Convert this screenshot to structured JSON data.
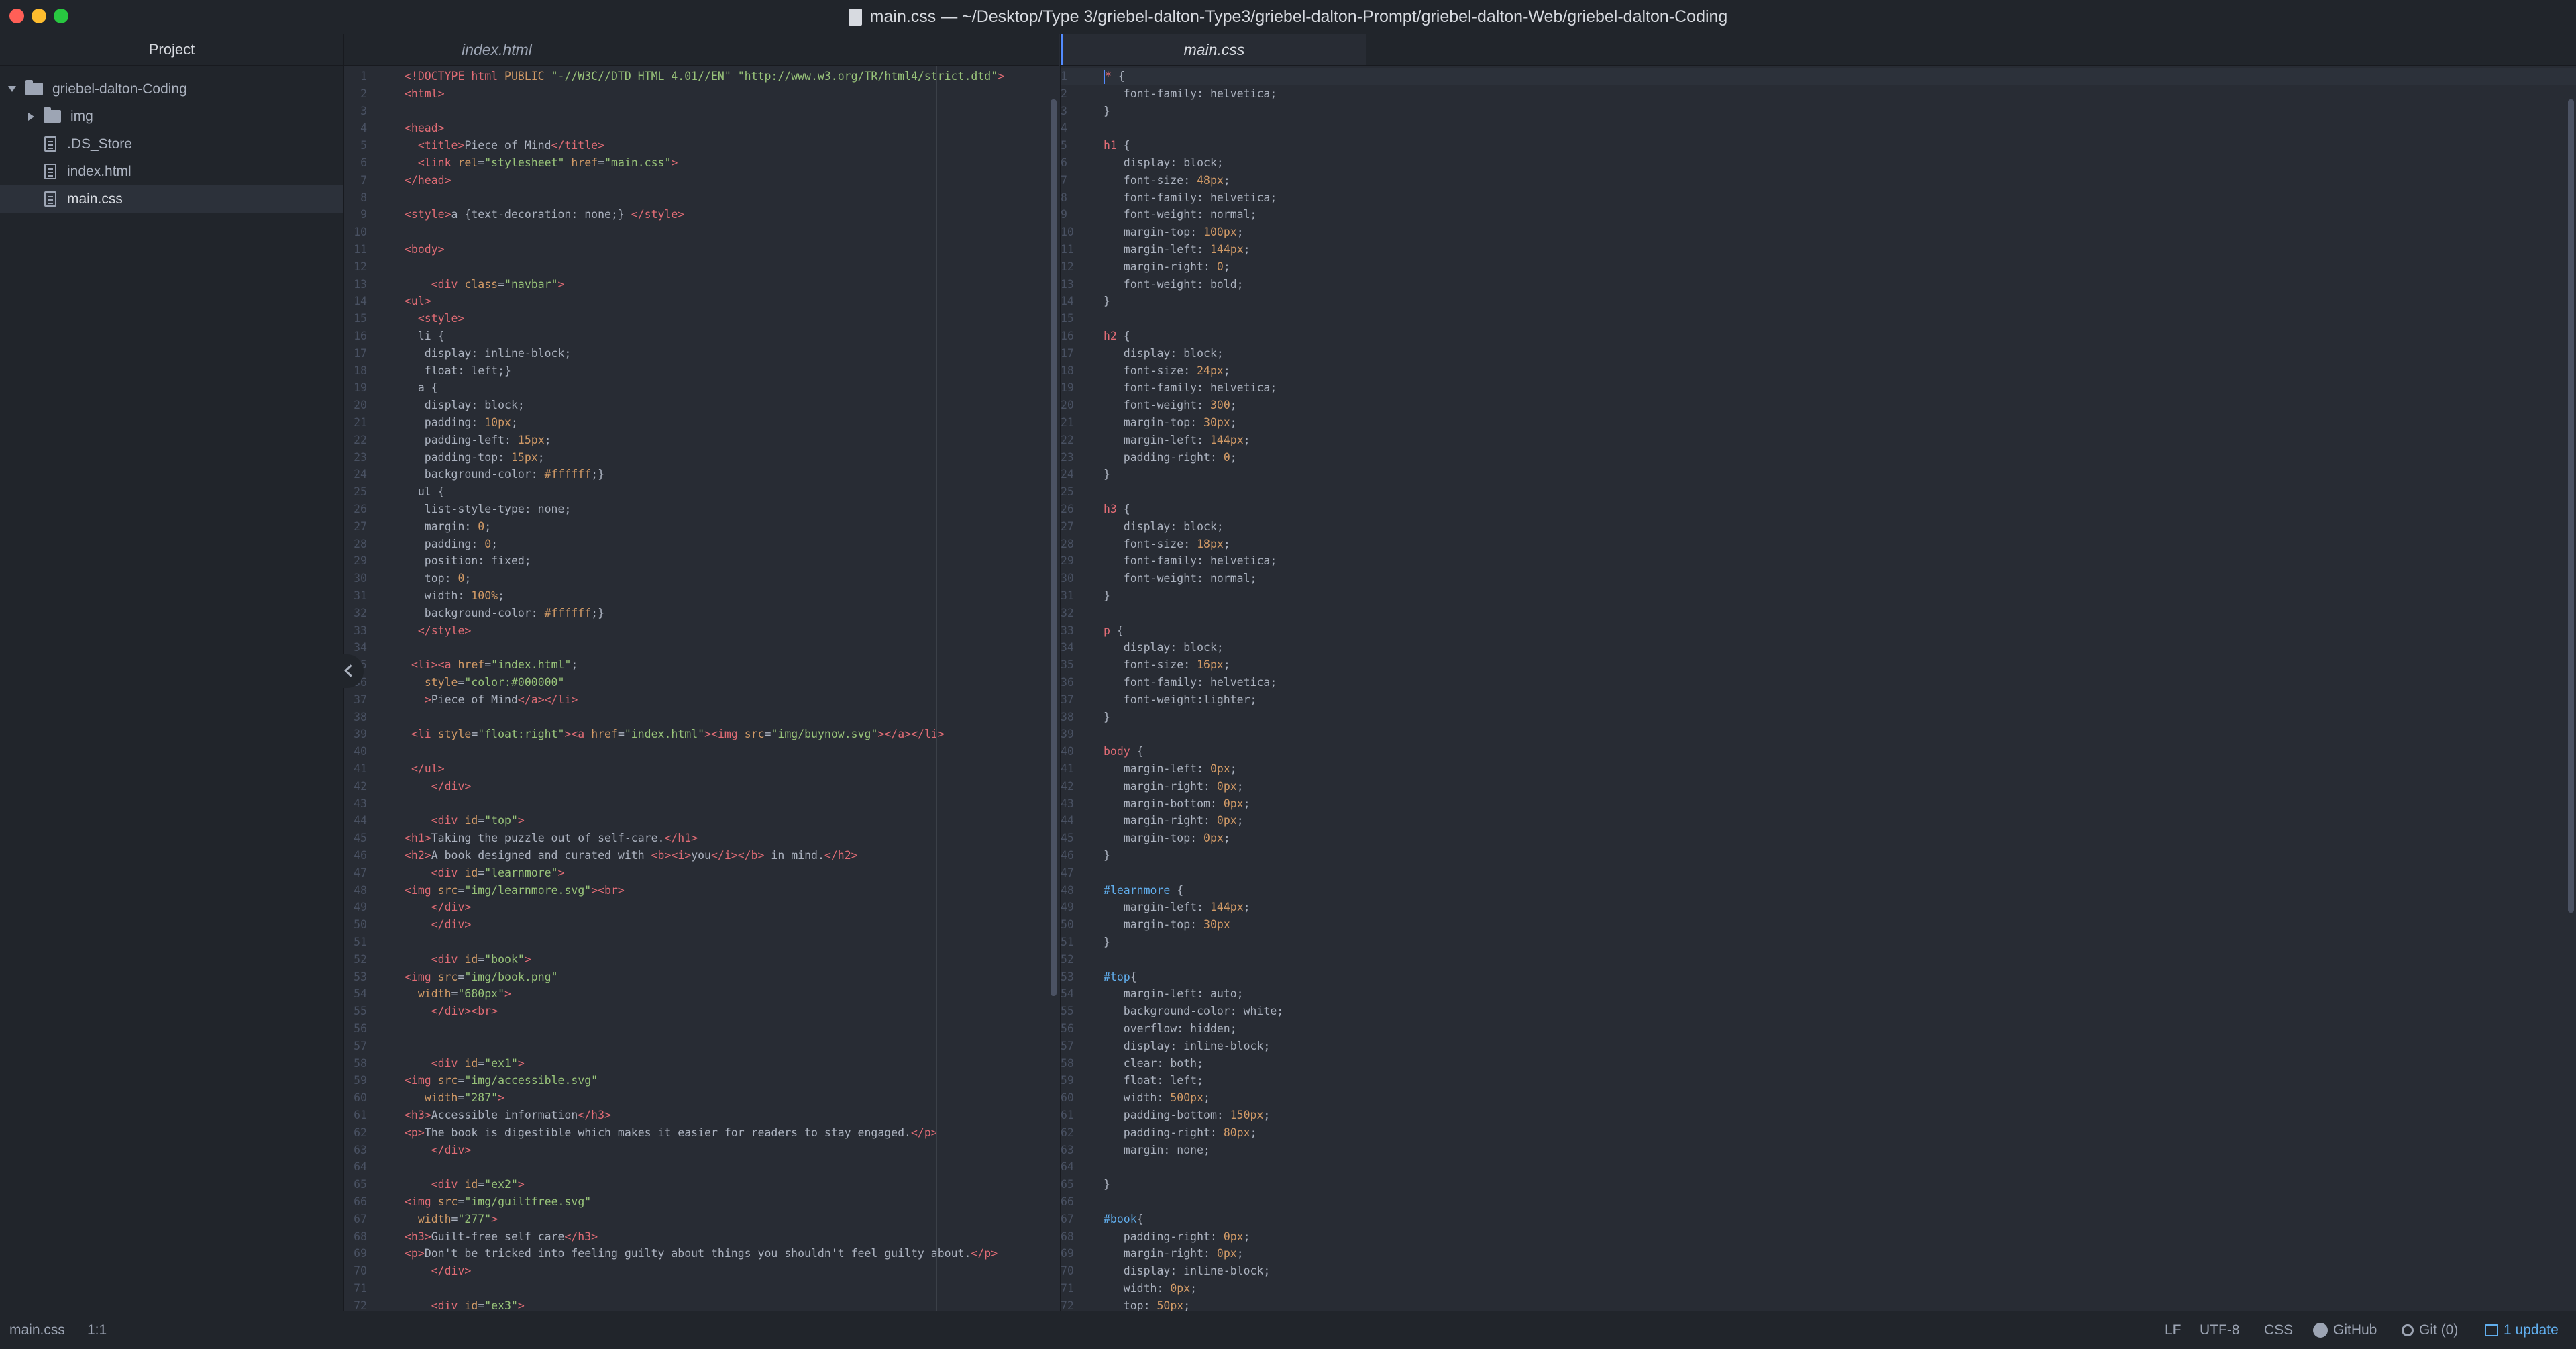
{
  "window": {
    "title": "main.css — ~/Desktop/Type 3/griebel-dalton-Type3/griebel-dalton-Prompt/griebel-dalton-Web/griebel-dalton-Coding"
  },
  "tree": {
    "header": "Project",
    "root": "griebel-dalton-Coding",
    "items": [
      {
        "label": "img",
        "kind": "folder"
      },
      {
        "label": ".DS_Store",
        "kind": "file"
      },
      {
        "label": "index.html",
        "kind": "file"
      },
      {
        "label": "main.css",
        "kind": "file",
        "selected": true
      }
    ]
  },
  "tabs": {
    "left": "index.html",
    "right": "main.css"
  },
  "editors": {
    "left_html": [
      "<span class=\"t\">&lt;!DOCTYPE html</span> <span class=\"a\">PUBLIC</span> <span class=\"s\">\"-//W3C//DTD HTML 4.01//EN\"</span> <span class=\"s\">\"http://www.w3.org/TR/html4/strict.dtd\"</span><span class=\"t\">&gt;</span>",
      "<span class=\"t\">&lt;html&gt;</span>",
      "",
      "<span class=\"t\">&lt;head&gt;</span>",
      "  <span class=\"t\">&lt;title&gt;</span>Piece of Mind<span class=\"t\">&lt;/title&gt;</span>",
      "  <span class=\"t\">&lt;link</span> <span class=\"a\">rel</span>=<span class=\"s\">\"stylesheet\"</span> <span class=\"a\">href</span>=<span class=\"s\">\"main.css\"</span><span class=\"t\">&gt;</span>",
      "<span class=\"t\">&lt;/head&gt;</span>",
      "",
      "<span class=\"t\">&lt;style&gt;</span>a {text-decoration: none;} <span class=\"t\">&lt;/style&gt;</span>",
      "",
      "<span class=\"t\">&lt;body&gt;</span>",
      "",
      "    <span class=\"t\">&lt;div</span> <span class=\"a\">class</span>=<span class=\"s\">\"navbar\"</span><span class=\"t\">&gt;</span>",
      "<span class=\"t\">&lt;ul&gt;</span>",
      "  <span class=\"t\">&lt;style&gt;</span>",
      "  li {",
      "   display: inline-block;",
      "   float: left;}",
      "  a {",
      "   display: block;",
      "   padding: <span class=\"num\">10px</span>;",
      "   padding-left: <span class=\"num\">15px</span>;",
      "   padding-top: <span class=\"num\">15px</span>;",
      "   background-color: <span class=\"num\">#ffffff</span>;}",
      "  ul {",
      "   list-style-type: none;",
      "   margin: <span class=\"num\">0</span>;",
      "   padding: <span class=\"num\">0</span>;",
      "   position: fixed;",
      "   top: <span class=\"num\">0</span>;",
      "   width: <span class=\"num\">100%</span>;",
      "   background-color: <span class=\"num\">#ffffff</span>;}",
      "  <span class=\"t\">&lt;/style&gt;</span>",
      "",
      " <span class=\"t\">&lt;li&gt;&lt;a</span> <span class=\"a\">href</span>=<span class=\"s\">\"index.html\"</span>;",
      "   <span class=\"a\">style</span>=<span class=\"s\">\"color:#000000\"</span>",
      "   <span class=\"t\">&gt;</span>Piece of Mind<span class=\"t\">&lt;/a&gt;&lt;/li&gt;</span>",
      "",
      " <span class=\"t\">&lt;li</span> <span class=\"a\">style</span>=<span class=\"s\">\"float:right\"</span><span class=\"t\">&gt;&lt;a</span> <span class=\"a\">href</span>=<span class=\"s\">\"index.html\"</span><span class=\"t\">&gt;&lt;img</span> <span class=\"a\">src</span>=<span class=\"s\">\"img/buynow.svg\"</span><span class=\"t\">&gt;&lt;/a&gt;&lt;/li&gt;</span>",
      "",
      " <span class=\"t\">&lt;/ul&gt;</span>",
      "    <span class=\"t\">&lt;/div&gt;</span>",
      "",
      "    <span class=\"t\">&lt;div</span> <span class=\"a\">id</span>=<span class=\"s\">\"top\"</span><span class=\"t\">&gt;</span>",
      "<span class=\"t\">&lt;h1&gt;</span>Taking the puzzle out of self-care.<span class=\"t\">&lt;/h1&gt;</span>",
      "<span class=\"t\">&lt;h2&gt;</span>A book designed and curated with <span class=\"t\">&lt;b&gt;&lt;i&gt;</span>you<span class=\"t\">&lt;/i&gt;&lt;/b&gt;</span> in mind.<span class=\"t\">&lt;/h2&gt;</span>",
      "    <span class=\"t\">&lt;div</span> <span class=\"a\">id</span>=<span class=\"s\">\"learnmore\"</span><span class=\"t\">&gt;</span>",
      "<span class=\"t\">&lt;img</span> <span class=\"a\">src</span>=<span class=\"s\">\"img/learnmore.svg\"</span><span class=\"t\">&gt;&lt;br&gt;</span>",
      "    <span class=\"t\">&lt;/div&gt;</span>",
      "    <span class=\"t\">&lt;/div&gt;</span>",
      "",
      "    <span class=\"t\">&lt;div</span> <span class=\"a\">id</span>=<span class=\"s\">\"book\"</span><span class=\"t\">&gt;</span>",
      "<span class=\"t\">&lt;img</span> <span class=\"a\">src</span>=<span class=\"s\">\"img/book.png\"</span>",
      "  <span class=\"a\">width</span>=<span class=\"s\">\"680px\"</span><span class=\"t\">&gt;</span>",
      "    <span class=\"t\">&lt;/div&gt;&lt;br&gt;</span>",
      "",
      "",
      "    <span class=\"t\">&lt;div</span> <span class=\"a\">id</span>=<span class=\"s\">\"ex1\"</span><span class=\"t\">&gt;</span>",
      "<span class=\"t\">&lt;img</span> <span class=\"a\">src</span>=<span class=\"s\">\"img/accessible.svg\"</span>",
      "   <span class=\"a\">width</span>=<span class=\"s\">\"287\"</span><span class=\"t\">&gt;</span>",
      "<span class=\"t\">&lt;h3&gt;</span>Accessible information<span class=\"t\">&lt;/h3&gt;</span>",
      "<span class=\"t\">&lt;p&gt;</span>The book is digestible which makes it easier for readers to stay engaged.<span class=\"t\">&lt;/p&gt;</span>",
      "    <span class=\"t\">&lt;/div&gt;</span>",
      "",
      "    <span class=\"t\">&lt;div</span> <span class=\"a\">id</span>=<span class=\"s\">\"ex2\"</span><span class=\"t\">&gt;</span>",
      "<span class=\"t\">&lt;img</span> <span class=\"a\">src</span>=<span class=\"s\">\"img/guiltfree.svg\"</span>",
      "  <span class=\"a\">width</span>=<span class=\"s\">\"277\"</span><span class=\"t\">&gt;</span>",
      "<span class=\"t\">&lt;h3&gt;</span>Guilt-free self care<span class=\"t\">&lt;/h3&gt;</span>",
      "<span class=\"t\">&lt;p&gt;</span>Don't be tricked into feeling guilty about things you shouldn't feel guilty about.<span class=\"t\">&lt;/p&gt;</span>",
      "    <span class=\"t\">&lt;/div&gt;</span>",
      "",
      "    <span class=\"t\">&lt;div</span> <span class=\"a\">id</span>=<span class=\"s\">\"ex3\"</span><span class=\"t\">&gt;</span>"
    ],
    "right_html": [
      "<span class=\"cursor\"></span><span class=\"sel\">*</span> {",
      "   font-family: helvetica;",
      "}",
      "",
      "<span class=\"sel\">h1</span> {",
      "   display: block;",
      "   font-size: <span class=\"num\">48px</span>;",
      "   font-family: helvetica;",
      "   font-weight: normal;",
      "   margin-top: <span class=\"num\">100px</span>;",
      "   margin-left: <span class=\"num\">144px</span>;",
      "   margin-right: <span class=\"num\">0</span>;",
      "   font-weight: bold;",
      "}",
      "",
      "<span class=\"sel\">h2</span> {",
      "   display: block;",
      "   font-size: <span class=\"num\">24px</span>;",
      "   font-family: helvetica;",
      "   font-weight: <span class=\"num\">300</span>;",
      "   margin-top: <span class=\"num\">30px</span>;",
      "   margin-left: <span class=\"num\">144px</span>;",
      "   padding-right: <span class=\"num\">0</span>;",
      "}",
      "",
      "<span class=\"sel\">h3</span> {",
      "   display: block;",
      "   font-size: <span class=\"num\">18px</span>;",
      "   font-family: helvetica;",
      "   font-weight: normal;",
      "}",
      "",
      "<span class=\"sel\">p</span> {",
      "   display: block;",
      "   font-size: <span class=\"num\">16px</span>;",
      "   font-family: helvetica;",
      "   font-weight:lighter;",
      "}",
      "",
      "<span class=\"sel\">body</span> {",
      "   margin-left: <span class=\"num\">0px</span>;",
      "   margin-right: <span class=\"num\">0px</span>;",
      "   margin-bottom: <span class=\"num\">0px</span>;",
      "   margin-right: <span class=\"num\">0px</span>;",
      "   margin-top: <span class=\"num\">0px</span>;",
      "}",
      "",
      "<span class=\"idsel\">#learnmore</span> {",
      "   margin-left: <span class=\"num\">144px</span>;",
      "   margin-top: <span class=\"num\">30px</span>",
      "}",
      "",
      "<span class=\"idsel\">#top</span>{",
      "   margin-left: auto;",
      "   background-color: white;",
      "   overflow: hidden;",
      "   display: inline-block;",
      "   clear: both;",
      "   float: left;",
      "   width: <span class=\"num\">500px</span>;",
      "   padding-bottom: <span class=\"num\">150px</span>;",
      "   padding-right: <span class=\"num\">80px</span>;",
      "   margin: none;",
      "",
      "}",
      "",
      "<span class=\"idsel\">#book</span>{",
      "   padding-right: <span class=\"num\">0px</span>;",
      "   margin-right: <span class=\"num\">0px</span>;",
      "   display: inline-block;",
      "   width: <span class=\"num\">0px</span>;",
      "   top: <span class=\"num\">50px</span>;"
    ]
  },
  "status": {
    "file": "main.css",
    "cursor": "1:1",
    "line_ending": "LF",
    "encoding": "UTF-8",
    "grammar": "CSS",
    "github": "GitHub",
    "git": "Git (0)",
    "update": "1 update"
  },
  "colors": {
    "background": "#282c34",
    "panel": "#21252b",
    "accent": "#528bff"
  }
}
